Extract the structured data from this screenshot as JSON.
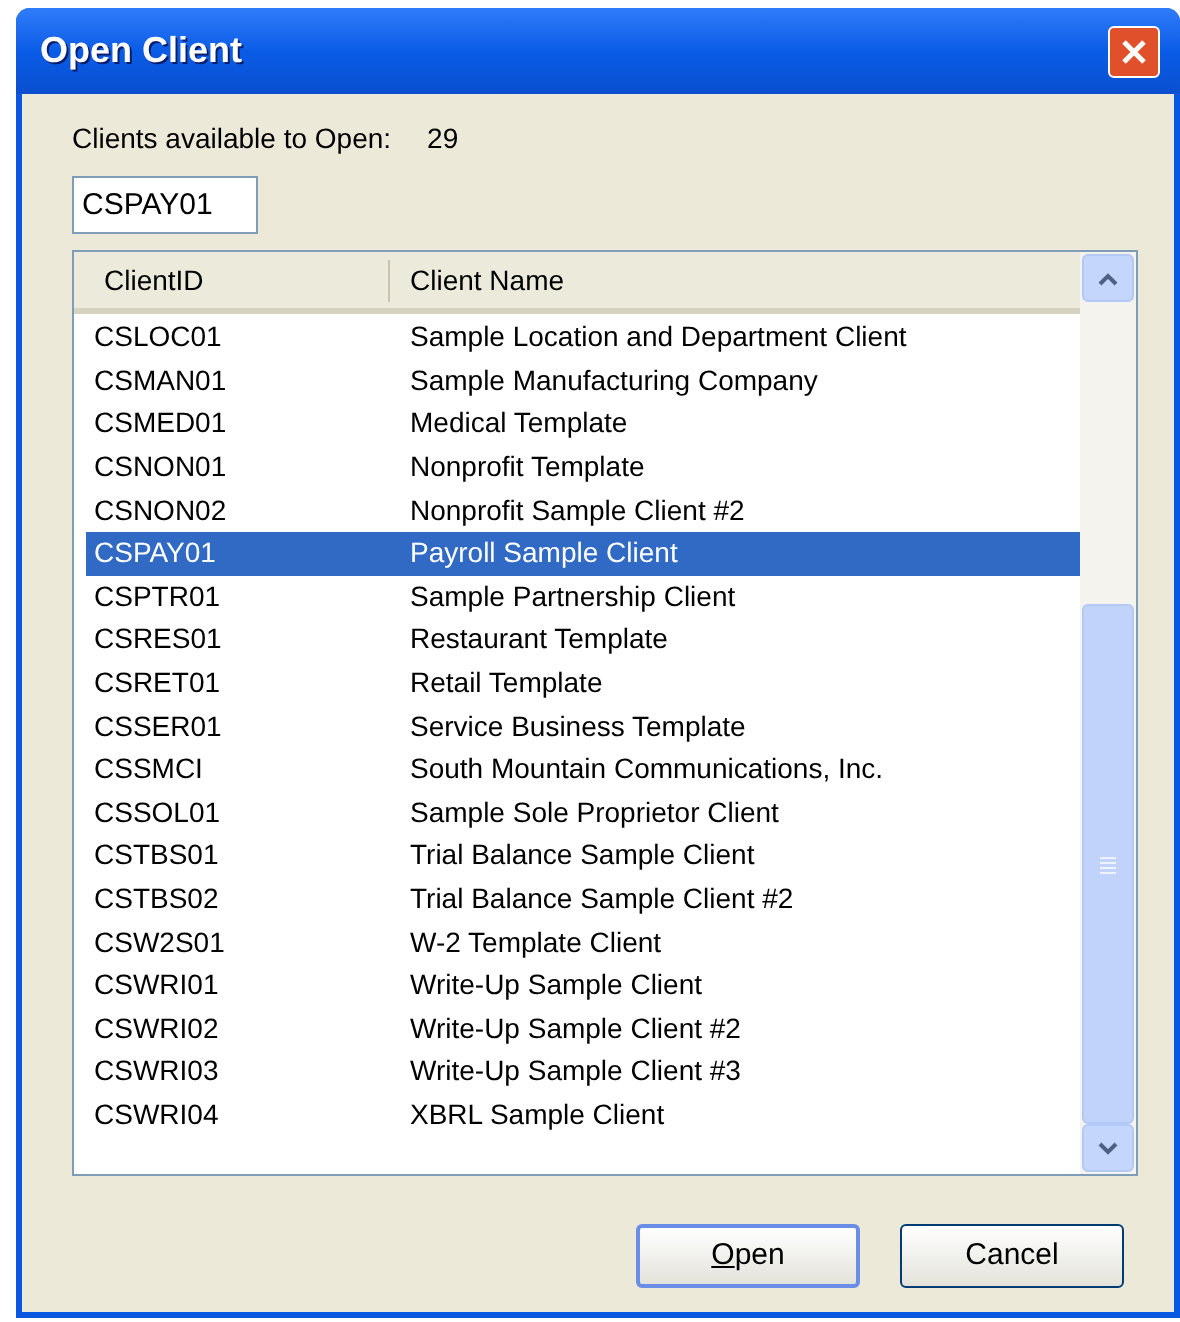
{
  "window": {
    "title": "Open Client"
  },
  "count": {
    "label": "Clients available to Open:",
    "value": "29"
  },
  "search": {
    "value": "CSPAY01"
  },
  "table": {
    "columns": [
      "ClientID",
      "Client Name"
    ],
    "rows": [
      {
        "id": "CSLOC01",
        "name": "Sample Location and Department Client",
        "selected": false
      },
      {
        "id": "CSMAN01",
        "name": "Sample Manufacturing Company",
        "selected": false
      },
      {
        "id": "CSMED01",
        "name": "Medical Template",
        "selected": false
      },
      {
        "id": "CSNON01",
        "name": "Nonprofit Template",
        "selected": false
      },
      {
        "id": "CSNON02",
        "name": "Nonprofit Sample Client #2",
        "selected": false
      },
      {
        "id": "CSPAY01",
        "name": "Payroll Sample Client",
        "selected": true
      },
      {
        "id": "CSPTR01",
        "name": "Sample Partnership Client",
        "selected": false
      },
      {
        "id": "CSRES01",
        "name": "Restaurant Template",
        "selected": false
      },
      {
        "id": "CSRET01",
        "name": "Retail Template",
        "selected": false
      },
      {
        "id": "CSSER01",
        "name": "Service Business Template",
        "selected": false
      },
      {
        "id": "CSSMCI",
        "name": "South Mountain Communications, Inc.",
        "selected": false
      },
      {
        "id": "CSSOL01",
        "name": "Sample Sole Proprietor Client",
        "selected": false
      },
      {
        "id": "CSTBS01",
        "name": "Trial Balance Sample Client",
        "selected": false
      },
      {
        "id": "CSTBS02",
        "name": "Trial Balance Sample Client #2",
        "selected": false
      },
      {
        "id": "CSW2S01",
        "name": "W-2 Template Client",
        "selected": false
      },
      {
        "id": "CSWRI01",
        "name": "Write-Up Sample Client",
        "selected": false
      },
      {
        "id": "CSWRI02",
        "name": "Write-Up Sample Client #2",
        "selected": false
      },
      {
        "id": "CSWRI03",
        "name": "Write-Up Sample Client #3",
        "selected": false
      },
      {
        "id": "CSWRI04",
        "name": "XBRL Sample Client",
        "selected": false
      }
    ]
  },
  "buttons": [
    {
      "label": "Open",
      "default": true
    },
    {
      "label": "Cancel",
      "default": false
    }
  ]
}
